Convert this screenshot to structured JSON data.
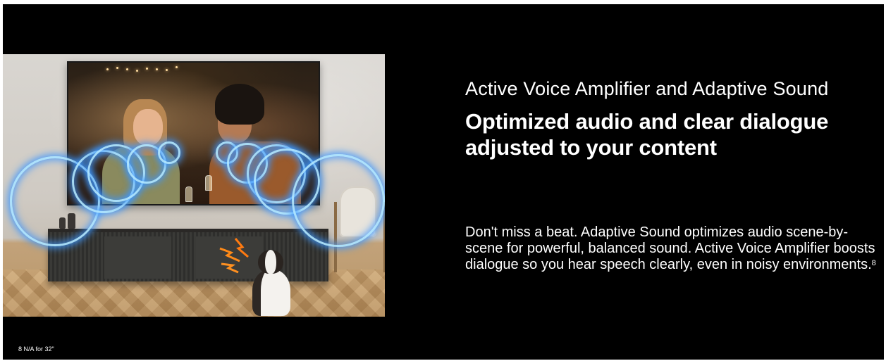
{
  "banner": {
    "subtitle": "Active Voice Amplifier and Adaptive Sound",
    "headline": "Optimized audio and clear dialogue adjusted to your content",
    "body": "Don't miss a beat. Adaptive Sound optimizes audio scene-by-scene for powerful, balanced sound. Active Voice Amplifier boosts dialogue so you hear speech clearly, even in noisy environments.",
    "footnote_marker": "8",
    "footnote": "8 N/A for 32\""
  },
  "colors": {
    "background": "#000000",
    "text": "#ffffff",
    "sound_ring_glow": "#3c96ff"
  },
  "image": {
    "description_icons": [
      "tv-icon",
      "sound-wave-icon",
      "dog-icon",
      "bark-icon"
    ]
  }
}
